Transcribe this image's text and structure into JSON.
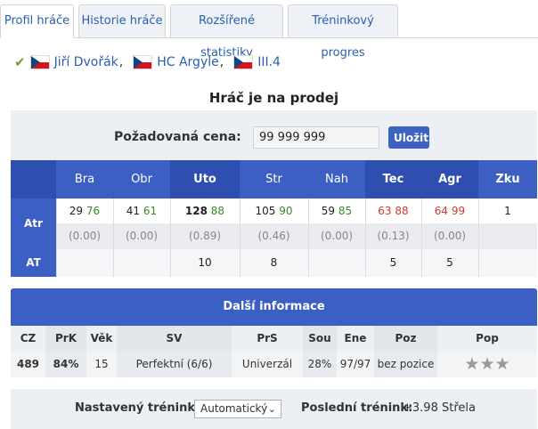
{
  "tabs": [
    {
      "label": "Profil hráče",
      "active": true
    },
    {
      "label": "Historie hráče",
      "active": false
    },
    {
      "label": "Rozšířené statistiky",
      "active": false
    },
    {
      "label": "Tréninkový progres",
      "active": false
    }
  ],
  "player": {
    "status_icon": "checkmark-icon",
    "flag": "czech-flag-icon",
    "name": "Jiří Dvořák",
    "team": "HC Argyle",
    "league": "III.4"
  },
  "sale": {
    "title": "Hráč je na prodej",
    "price_label": "Požadovaná cena:",
    "price_value": "99 999 999",
    "save_label": "Uložit"
  },
  "attributes": {
    "columns": [
      "Bra",
      "Obr",
      "Uto",
      "Str",
      "Nah",
      "Tec",
      "Agr",
      "Zku"
    ],
    "atr_label": "Atr",
    "at_label": "AT",
    "values": [
      {
        "value": "29",
        "max": "76",
        "color": "green",
        "extra": "(0.00)",
        "at": ""
      },
      {
        "value": "41",
        "max": "61",
        "color": "green",
        "extra": "(0.00)",
        "at": ""
      },
      {
        "value": "128",
        "max": "88",
        "color": "green",
        "extra": "(0.89)",
        "at": "10"
      },
      {
        "value": "105",
        "max": "90",
        "color": "green",
        "extra": "(0.46)",
        "at": "8"
      },
      {
        "value": "59",
        "max": "85",
        "color": "green",
        "extra": "(0.00)",
        "at": ""
      },
      {
        "value": "63",
        "max": "88",
        "color": "red",
        "extra": "(0.13)",
        "at": "5"
      },
      {
        "value": "64",
        "max": "99",
        "color": "red",
        "extra": "(0.00)",
        "at": "5"
      },
      {
        "value": "1",
        "max": "",
        "color": "",
        "extra": "",
        "at": ""
      }
    ]
  },
  "info": {
    "title": "Další informace",
    "headers": [
      "CZ",
      "PrK",
      "Věk",
      "SV",
      "PrS",
      "Sou",
      "Ene",
      "Poz",
      "Pop"
    ],
    "values": [
      "489",
      "84%",
      "15",
      "Perfektní (6/6)",
      "Univerzál",
      "28%",
      "97/97",
      "bez pozice",
      ""
    ],
    "popularity_stars": 3
  },
  "training": {
    "label": "Nastavený trénink:",
    "selected": "Automatický",
    "last_label": "Poslední trénink:",
    "last_value": "+3.98 Střela"
  }
}
